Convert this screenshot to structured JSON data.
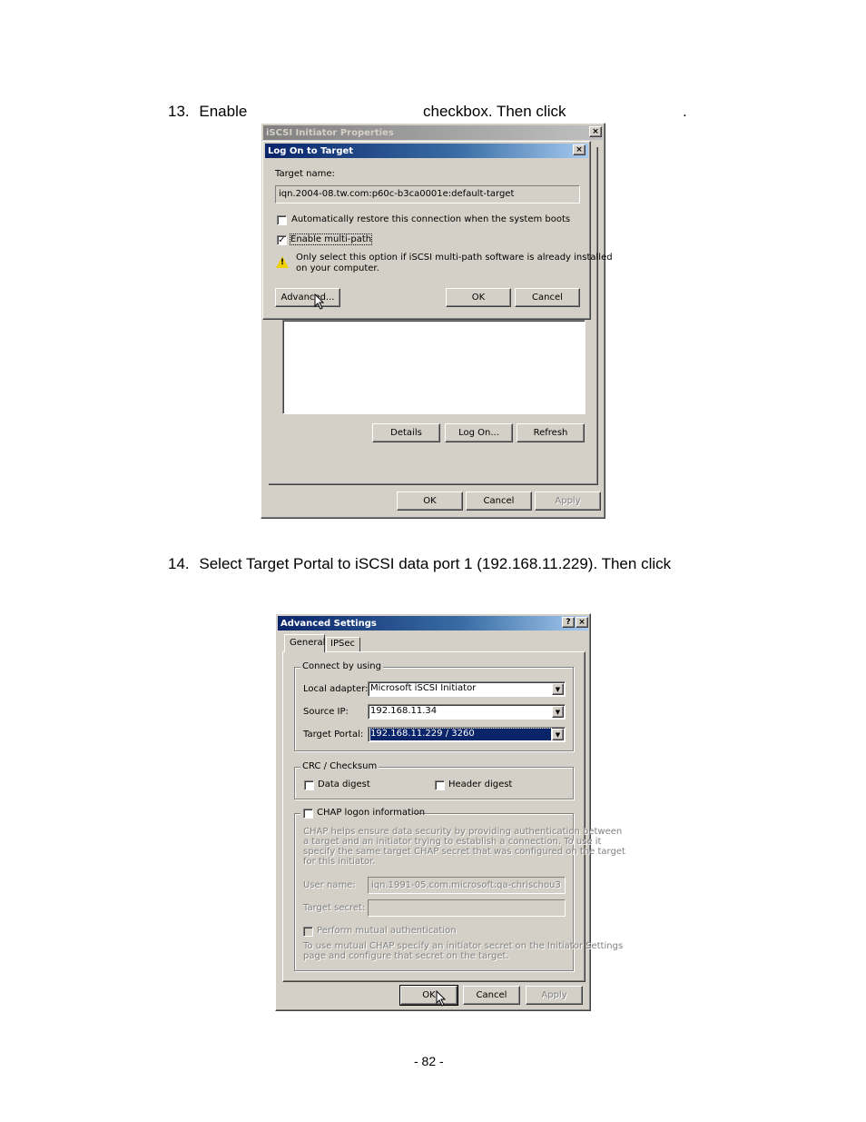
{
  "step13": {
    "number": "13.",
    "text_before": "Enable",
    "text_middle": "checkbox. Then click",
    "text_after": "."
  },
  "iscsi_window": {
    "title": "iSCSI Initiator Properties",
    "close_glyph": "×",
    "buttons": {
      "details": "Details",
      "log_on": "Log On...",
      "refresh": "Refresh",
      "ok": "OK",
      "cancel": "Cancel",
      "apply": "Apply"
    }
  },
  "logon_dialog": {
    "title": "Log On to Target",
    "close_glyph": "×",
    "target_name_label": "Target name:",
    "target_name_value": "iqn.2004-08.tw.com:p60c-b3ca0001e:default-target",
    "auto_restore_label": "Automatically restore this connection when the system boots",
    "auto_restore_checked": false,
    "multipath_label": "Enable multi-path",
    "multipath_checked": true,
    "warning_text_line1": "Only select this option if iSCSI multi-path software is already installed",
    "warning_text_line2": "on your computer.",
    "warning_icon_glyph": "!",
    "check_glyph": "✓",
    "buttons": {
      "advanced": "Advanced...",
      "ok": "OK",
      "cancel": "Cancel"
    }
  },
  "step14": {
    "number": "14.",
    "text": "Select Target Portal to iSCSI data port 1 (192.168.11.229). Then click"
  },
  "advanced_dialog": {
    "title": "Advanced Settings",
    "help_glyph": "?",
    "close_glyph": "×",
    "tabs": [
      {
        "label": "General",
        "active": true
      },
      {
        "label": "IPSec",
        "active": false
      }
    ],
    "connect_group": {
      "title": "Connect by using",
      "local_adapter_label": "Local adapter:",
      "local_adapter_value": "Microsoft iSCSI Initiator",
      "source_ip_label": "Source IP:",
      "source_ip_value": "192.168.11.34",
      "target_portal_label": "Target Portal:",
      "target_portal_value": "192.168.11.229 / 3260",
      "dropdown_glyph": "▼"
    },
    "crc_group": {
      "title": "CRC / Checksum",
      "data_digest_label": "Data digest",
      "data_digest_checked": false,
      "header_digest_label": "Header digest",
      "header_digest_checked": false
    },
    "chap_group": {
      "title": "CHAP logon information",
      "checked": false,
      "description_lines": [
        "CHAP helps ensure data security by providing authentication between",
        "a target and an initiator trying to establish a connection. To use it",
        "specify the same target CHAP secret that was configured on the target",
        "for this initiator."
      ],
      "user_name_label": "User name:",
      "user_name_value": "iqn.1991-05.com.microsoft:qa-chrischou3",
      "target_secret_label": "Target secret:",
      "target_secret_value": "",
      "mutual_auth_label": "Perform mutual authentication",
      "mutual_auth_checked": false,
      "mutual_note_lines": [
        "To use mutual CHAP specify an initiator secret on the Initiator Settings",
        "page and configure that secret on the target."
      ]
    },
    "buttons": {
      "ok": "OK",
      "cancel": "Cancel",
      "apply": "Apply"
    }
  },
  "footer": {
    "page_number": "- 82 -"
  }
}
